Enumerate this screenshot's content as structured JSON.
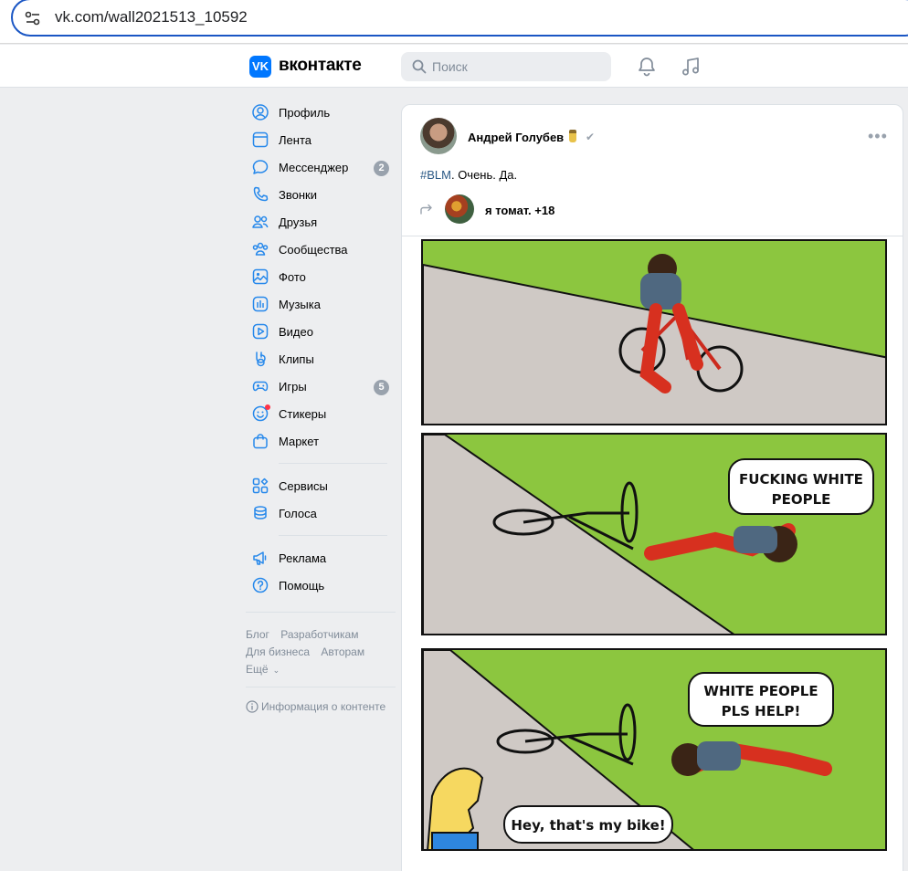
{
  "browser": {
    "url": "vk.com/wall2021513_10592"
  },
  "header": {
    "logo_mark": "VK",
    "logo_text": "вконтакте",
    "search_placeholder": "Поиск",
    "icons": [
      "bell-icon",
      "music-icon"
    ]
  },
  "sidebar": {
    "items": [
      {
        "label": "Профиль",
        "icon": "user-circle-icon"
      },
      {
        "label": "Лента",
        "icon": "newsfeed-icon"
      },
      {
        "label": "Мессенджер",
        "icon": "message-icon",
        "count": "2"
      },
      {
        "label": "Звонки",
        "icon": "phone-icon"
      },
      {
        "label": "Друзья",
        "icon": "friends-icon"
      },
      {
        "label": "Сообщества",
        "icon": "communities-icon"
      },
      {
        "label": "Фото",
        "icon": "photo-icon"
      },
      {
        "label": "Музыка",
        "icon": "music-icon"
      },
      {
        "label": "Видео",
        "icon": "video-icon"
      },
      {
        "label": "Клипы",
        "icon": "clips-icon"
      },
      {
        "label": "Игры",
        "icon": "gamepad-icon",
        "count": "5"
      },
      {
        "label": "Стикеры",
        "icon": "smile-icon"
      },
      {
        "label": "Маркет",
        "icon": "shopping-bag-icon"
      }
    ],
    "items_group2": [
      {
        "label": "Сервисы",
        "icon": "services-icon"
      },
      {
        "label": "Голоса",
        "icon": "coins-icon"
      }
    ],
    "items_group3": [
      {
        "label": "Реклама",
        "icon": "megaphone-icon"
      },
      {
        "label": "Помощь",
        "icon": "help-icon"
      }
    ],
    "footer_links": [
      "Блог",
      "Разработчикам",
      "Для бизнеса",
      "Авторам",
      "Ещё"
    ],
    "info_link": "Информация о контенте"
  },
  "post": {
    "author": "Андрей Голубев",
    "text_tag": "#BLM",
    "text_rest": ". Очень. Да.",
    "repost_name": "я томат. +18",
    "comic": {
      "bubble1": "FUCKING WHITE PEOPLE",
      "bubble2": "WHITE PEOPLE PLS HELP!",
      "bubble3": "Hey, that's my bike!"
    }
  }
}
